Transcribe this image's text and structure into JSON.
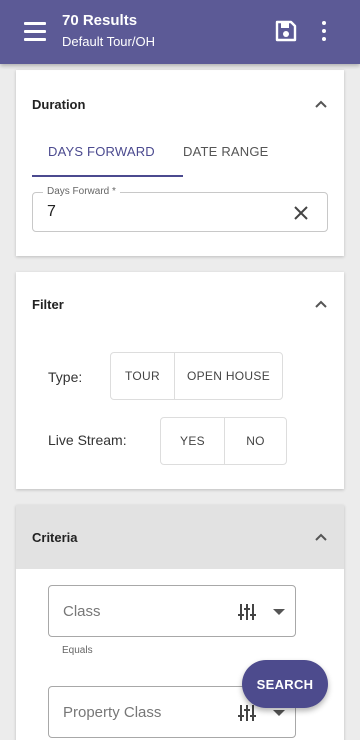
{
  "header": {
    "title": "70 Results",
    "subtitle": "Default Tour/OH",
    "menu_icon": "menu-icon",
    "save_icon": "save-icon",
    "more_icon": "more-vert-icon",
    "color": "#5c5a96"
  },
  "duration": {
    "title": "Duration",
    "tabs": [
      {
        "label": "DAYS FORWARD",
        "active": true
      },
      {
        "label": "DATE RANGE",
        "active": false
      }
    ],
    "days_forward": {
      "label": "Days Forward *",
      "value": "7"
    }
  },
  "filter": {
    "title": "Filter",
    "type": {
      "label": "Type:",
      "options": [
        "TOUR",
        "OPEN HOUSE"
      ]
    },
    "live_stream": {
      "label": "Live Stream:",
      "options": [
        "YES",
        "NO"
      ]
    }
  },
  "criteria": {
    "title": "Criteria",
    "fields": [
      {
        "placeholder": "Class",
        "helper": "Equals"
      },
      {
        "placeholder": "Property Class",
        "helper": ""
      }
    ]
  },
  "search_button": {
    "label": "SEARCH",
    "color": "#4d4b8d"
  }
}
